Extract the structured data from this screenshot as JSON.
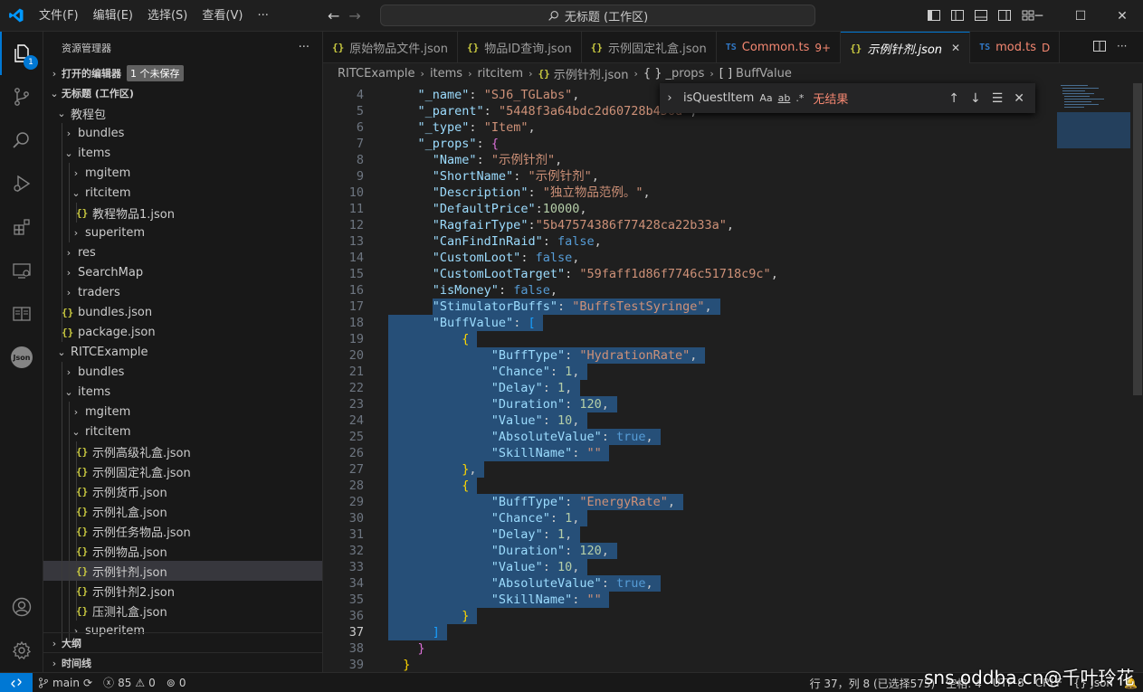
{
  "titlebar": {
    "menus": [
      "文件(F)",
      "编辑(E)",
      "选择(S)",
      "查看(V)",
      "···"
    ],
    "search_text": "无标题 (工作区)"
  },
  "activity": {
    "explorer_badge": "1",
    "json_label": "Json"
  },
  "sidebar": {
    "title": "资源管理器",
    "more": "···",
    "open_editors": "打开的编辑器",
    "unsaved": "1 个未保存",
    "workspace": "无标题 (工作区)",
    "tree": [
      {
        "label": "教程包",
        "indent": 1,
        "type": "folder-open"
      },
      {
        "label": "bundles",
        "indent": 2,
        "type": "folder"
      },
      {
        "label": "items",
        "indent": 2,
        "type": "folder-open"
      },
      {
        "label": "mgitem",
        "indent": 3,
        "type": "folder"
      },
      {
        "label": "ritcitem",
        "indent": 3,
        "type": "folder-open"
      },
      {
        "label": "教程物品1.json",
        "indent": 4,
        "type": "json"
      },
      {
        "label": "superitem",
        "indent": 3,
        "type": "folder"
      },
      {
        "label": "res",
        "indent": 2,
        "type": "folder"
      },
      {
        "label": "SearchMap",
        "indent": 2,
        "type": "folder"
      },
      {
        "label": "traders",
        "indent": 2,
        "type": "folder"
      },
      {
        "label": "bundles.json",
        "indent": 2,
        "type": "json"
      },
      {
        "label": "package.json",
        "indent": 2,
        "type": "json"
      },
      {
        "label": "RITCExample",
        "indent": 1,
        "type": "folder-open"
      },
      {
        "label": "bundles",
        "indent": 2,
        "type": "folder"
      },
      {
        "label": "items",
        "indent": 2,
        "type": "folder-open"
      },
      {
        "label": "mgitem",
        "indent": 3,
        "type": "folder"
      },
      {
        "label": "ritcitem",
        "indent": 3,
        "type": "folder-open"
      },
      {
        "label": "示例高级礼盒.json",
        "indent": 4,
        "type": "json"
      },
      {
        "label": "示例固定礼盒.json",
        "indent": 4,
        "type": "json"
      },
      {
        "label": "示例货币.json",
        "indent": 4,
        "type": "json"
      },
      {
        "label": "示例礼盒.json",
        "indent": 4,
        "type": "json"
      },
      {
        "label": "示例任务物品.json",
        "indent": 4,
        "type": "json"
      },
      {
        "label": "示例物品.json",
        "indent": 4,
        "type": "json"
      },
      {
        "label": "示例针剂.json",
        "indent": 4,
        "type": "json",
        "selected": true
      },
      {
        "label": "示例针剂2.json",
        "indent": 4,
        "type": "json"
      },
      {
        "label": "压测礼盒.json",
        "indent": 4,
        "type": "json"
      },
      {
        "label": "superitem",
        "indent": 3,
        "type": "folder"
      }
    ],
    "outline": "大纲",
    "timeline": "时间线"
  },
  "tabs": [
    {
      "label": "原始物品文件.json",
      "kind": "json"
    },
    {
      "label": "物品ID查询.json",
      "kind": "json"
    },
    {
      "label": "示例固定礼盒.json",
      "kind": "json"
    },
    {
      "label": "Common.ts",
      "kind": "ts",
      "suffix": "9+"
    },
    {
      "label": "示例针剂.json",
      "kind": "json",
      "active": true
    },
    {
      "label": "mod.ts",
      "kind": "ts",
      "suffix": "D"
    }
  ],
  "breadcrumb": [
    "RITCExample",
    "items",
    "ritcitem",
    "示例针剂.json",
    "_props",
    "BuffValue"
  ],
  "find": {
    "value": "isQuestItem",
    "opt_case": "Aa",
    "opt_word": "ab",
    "opt_regex": ".*",
    "result": "无结果"
  },
  "code_lines": [
    {
      "n": "4",
      "t": [
        [
          "p",
          "    "
        ],
        [
          "k",
          "\"_name\""
        ],
        [
          "p",
          ": "
        ],
        [
          "s",
          "\"SJ6_TGLabs\""
        ],
        [
          "p",
          ","
        ]
      ]
    },
    {
      "n": "5",
      "t": [
        [
          "p",
          "    "
        ],
        [
          "k",
          "\"_parent\""
        ],
        [
          "p",
          ": "
        ],
        [
          "s",
          "\"5448f3a64bdc2d60728b456d\""
        ],
        [
          "p",
          ","
        ]
      ]
    },
    {
      "n": "6",
      "t": [
        [
          "p",
          "    "
        ],
        [
          "k",
          "\"_type\""
        ],
        [
          "p",
          ": "
        ],
        [
          "s",
          "\"Item\""
        ],
        [
          "p",
          ","
        ]
      ]
    },
    {
      "n": "7",
      "t": [
        [
          "p",
          "    "
        ],
        [
          "k",
          "\"_props\""
        ],
        [
          "p",
          ": "
        ],
        [
          "br2",
          "{"
        ]
      ]
    },
    {
      "n": "8",
      "t": [
        [
          "p",
          "      "
        ],
        [
          "k",
          "\"Name\""
        ],
        [
          "p",
          ": "
        ],
        [
          "s",
          "\"示例针剂\""
        ],
        [
          "p",
          ","
        ]
      ]
    },
    {
      "n": "9",
      "t": [
        [
          "p",
          "      "
        ],
        [
          "k",
          "\"ShortName\""
        ],
        [
          "p",
          ": "
        ],
        [
          "s",
          "\"示例针剂\""
        ],
        [
          "p",
          ","
        ]
      ]
    },
    {
      "n": "10",
      "t": [
        [
          "p",
          "      "
        ],
        [
          "k",
          "\"Description\""
        ],
        [
          "p",
          ": "
        ],
        [
          "s",
          "\"独立物品范例。\""
        ],
        [
          "p",
          ","
        ]
      ]
    },
    {
      "n": "11",
      "t": [
        [
          "p",
          "      "
        ],
        [
          "k",
          "\"DefaultPrice\""
        ],
        [
          "p",
          ":"
        ],
        [
          "n",
          "10000"
        ],
        [
          "p",
          ","
        ]
      ]
    },
    {
      "n": "12",
      "t": [
        [
          "p",
          "      "
        ],
        [
          "k",
          "\"RagfairType\""
        ],
        [
          "p",
          ":"
        ],
        [
          "s",
          "\"5b47574386f77428ca22b33a\""
        ],
        [
          "p",
          ","
        ]
      ]
    },
    {
      "n": "13",
      "t": [
        [
          "p",
          "      "
        ],
        [
          "k",
          "\"CanFindInRaid\""
        ],
        [
          "p",
          ": "
        ],
        [
          "b",
          "false"
        ],
        [
          "p",
          ","
        ]
      ]
    },
    {
      "n": "14",
      "t": [
        [
          "p",
          "      "
        ],
        [
          "k",
          "\"CustomLoot\""
        ],
        [
          "p",
          ": "
        ],
        [
          "b",
          "false"
        ],
        [
          "p",
          ","
        ]
      ]
    },
    {
      "n": "15",
      "t": [
        [
          "p",
          "      "
        ],
        [
          "k",
          "\"CustomLootTarget\""
        ],
        [
          "p",
          ": "
        ],
        [
          "s",
          "\"59faff1d86f7746c51718c9c\""
        ],
        [
          "p",
          ","
        ]
      ]
    },
    {
      "n": "16",
      "t": [
        [
          "p",
          "      "
        ],
        [
          "k",
          "\"isMoney\""
        ],
        [
          "p",
          ": "
        ],
        [
          "b",
          "false"
        ],
        [
          "p",
          ","
        ]
      ]
    },
    {
      "n": "17",
      "t": [
        [
          "p",
          "      "
        ],
        [
          "k",
          "\"StimulatorBuffs\""
        ],
        [
          "p",
          ": "
        ],
        [
          "s",
          "\"BuffsTestSyringe\""
        ],
        [
          "p",
          ","
        ]
      ]
    },
    {
      "n": "18",
      "t": [
        [
          "p",
          "      "
        ],
        [
          "k",
          "\"BuffValue\""
        ],
        [
          "p",
          ": "
        ],
        [
          "br3",
          "["
        ]
      ]
    },
    {
      "n": "19",
      "t": [
        [
          "p",
          "          "
        ],
        [
          "br1",
          "{"
        ]
      ]
    },
    {
      "n": "20",
      "t": [
        [
          "p",
          "              "
        ],
        [
          "k",
          "\"BuffType\""
        ],
        [
          "p",
          ": "
        ],
        [
          "s",
          "\"HydrationRate\""
        ],
        [
          "p",
          ","
        ]
      ]
    },
    {
      "n": "21",
      "t": [
        [
          "p",
          "              "
        ],
        [
          "k",
          "\"Chance\""
        ],
        [
          "p",
          ": "
        ],
        [
          "n",
          "1"
        ],
        [
          "p",
          ","
        ]
      ]
    },
    {
      "n": "22",
      "t": [
        [
          "p",
          "              "
        ],
        [
          "k",
          "\"Delay\""
        ],
        [
          "p",
          ": "
        ],
        [
          "n",
          "1"
        ],
        [
          "p",
          ","
        ]
      ]
    },
    {
      "n": "23",
      "t": [
        [
          "p",
          "              "
        ],
        [
          "k",
          "\"Duration\""
        ],
        [
          "p",
          ": "
        ],
        [
          "n",
          "120"
        ],
        [
          "p",
          ","
        ]
      ]
    },
    {
      "n": "24",
      "t": [
        [
          "p",
          "              "
        ],
        [
          "k",
          "\"Value\""
        ],
        [
          "p",
          ": "
        ],
        [
          "n",
          "10"
        ],
        [
          "p",
          ","
        ]
      ]
    },
    {
      "n": "25",
      "t": [
        [
          "p",
          "              "
        ],
        [
          "k",
          "\"AbsoluteValue\""
        ],
        [
          "p",
          ": "
        ],
        [
          "b",
          "true"
        ],
        [
          "p",
          ","
        ]
      ]
    },
    {
      "n": "26",
      "t": [
        [
          "p",
          "              "
        ],
        [
          "k",
          "\"SkillName\""
        ],
        [
          "p",
          ": "
        ],
        [
          "s",
          "\"\""
        ]
      ]
    },
    {
      "n": "27",
      "t": [
        [
          "p",
          "          "
        ],
        [
          "br1",
          "}"
        ],
        [
          "p",
          ","
        ]
      ]
    },
    {
      "n": "28",
      "t": [
        [
          "p",
          "          "
        ],
        [
          "br1",
          "{"
        ]
      ]
    },
    {
      "n": "29",
      "t": [
        [
          "p",
          "              "
        ],
        [
          "k",
          "\"BuffType\""
        ],
        [
          "p",
          ": "
        ],
        [
          "s",
          "\"EnergyRate\""
        ],
        [
          "p",
          ","
        ]
      ]
    },
    {
      "n": "30",
      "t": [
        [
          "p",
          "              "
        ],
        [
          "k",
          "\"Chance\""
        ],
        [
          "p",
          ": "
        ],
        [
          "n",
          "1"
        ],
        [
          "p",
          ","
        ]
      ]
    },
    {
      "n": "31",
      "t": [
        [
          "p",
          "              "
        ],
        [
          "k",
          "\"Delay\""
        ],
        [
          "p",
          ": "
        ],
        [
          "n",
          "1"
        ],
        [
          "p",
          ","
        ]
      ]
    },
    {
      "n": "32",
      "t": [
        [
          "p",
          "              "
        ],
        [
          "k",
          "\"Duration\""
        ],
        [
          "p",
          ": "
        ],
        [
          "n",
          "120"
        ],
        [
          "p",
          ","
        ]
      ]
    },
    {
      "n": "33",
      "t": [
        [
          "p",
          "              "
        ],
        [
          "k",
          "\"Value\""
        ],
        [
          "p",
          ": "
        ],
        [
          "n",
          "10"
        ],
        [
          "p",
          ","
        ]
      ]
    },
    {
      "n": "34",
      "t": [
        [
          "p",
          "              "
        ],
        [
          "k",
          "\"AbsoluteValue\""
        ],
        [
          "p",
          ": "
        ],
        [
          "b",
          "true"
        ],
        [
          "p",
          ","
        ]
      ]
    },
    {
      "n": "35",
      "t": [
        [
          "p",
          "              "
        ],
        [
          "k",
          "\"SkillName\""
        ],
        [
          "p",
          ": "
        ],
        [
          "s",
          "\"\""
        ]
      ]
    },
    {
      "n": "36",
      "t": [
        [
          "p",
          "          "
        ],
        [
          "br1",
          "}"
        ]
      ]
    },
    {
      "n": "37",
      "t": [
        [
          "p",
          "      "
        ],
        [
          "br3",
          "]"
        ]
      ],
      "current": true
    },
    {
      "n": "38",
      "t": [
        [
          "p",
          "    "
        ],
        [
          "br2",
          "}"
        ]
      ]
    },
    {
      "n": "39",
      "t": [
        [
          "p",
          "  "
        ],
        [
          "br1",
          "}"
        ]
      ]
    }
  ],
  "statusbar": {
    "branch": "main",
    "errors": "85",
    "warnings": "0",
    "ports": "0",
    "cursor": "行 37，列 8 (已选择575)",
    "spaces": "空格: 4",
    "encoding": "UTF-8",
    "eol": "CRLF",
    "language": "Json"
  },
  "watermark": "sns.oddba.cn@千叶玲花",
  "colors": {
    "accent": "#0078d4",
    "selection": "#264f78",
    "json_icon": "#cbcb41",
    "ts_icon": "#3178c6"
  }
}
